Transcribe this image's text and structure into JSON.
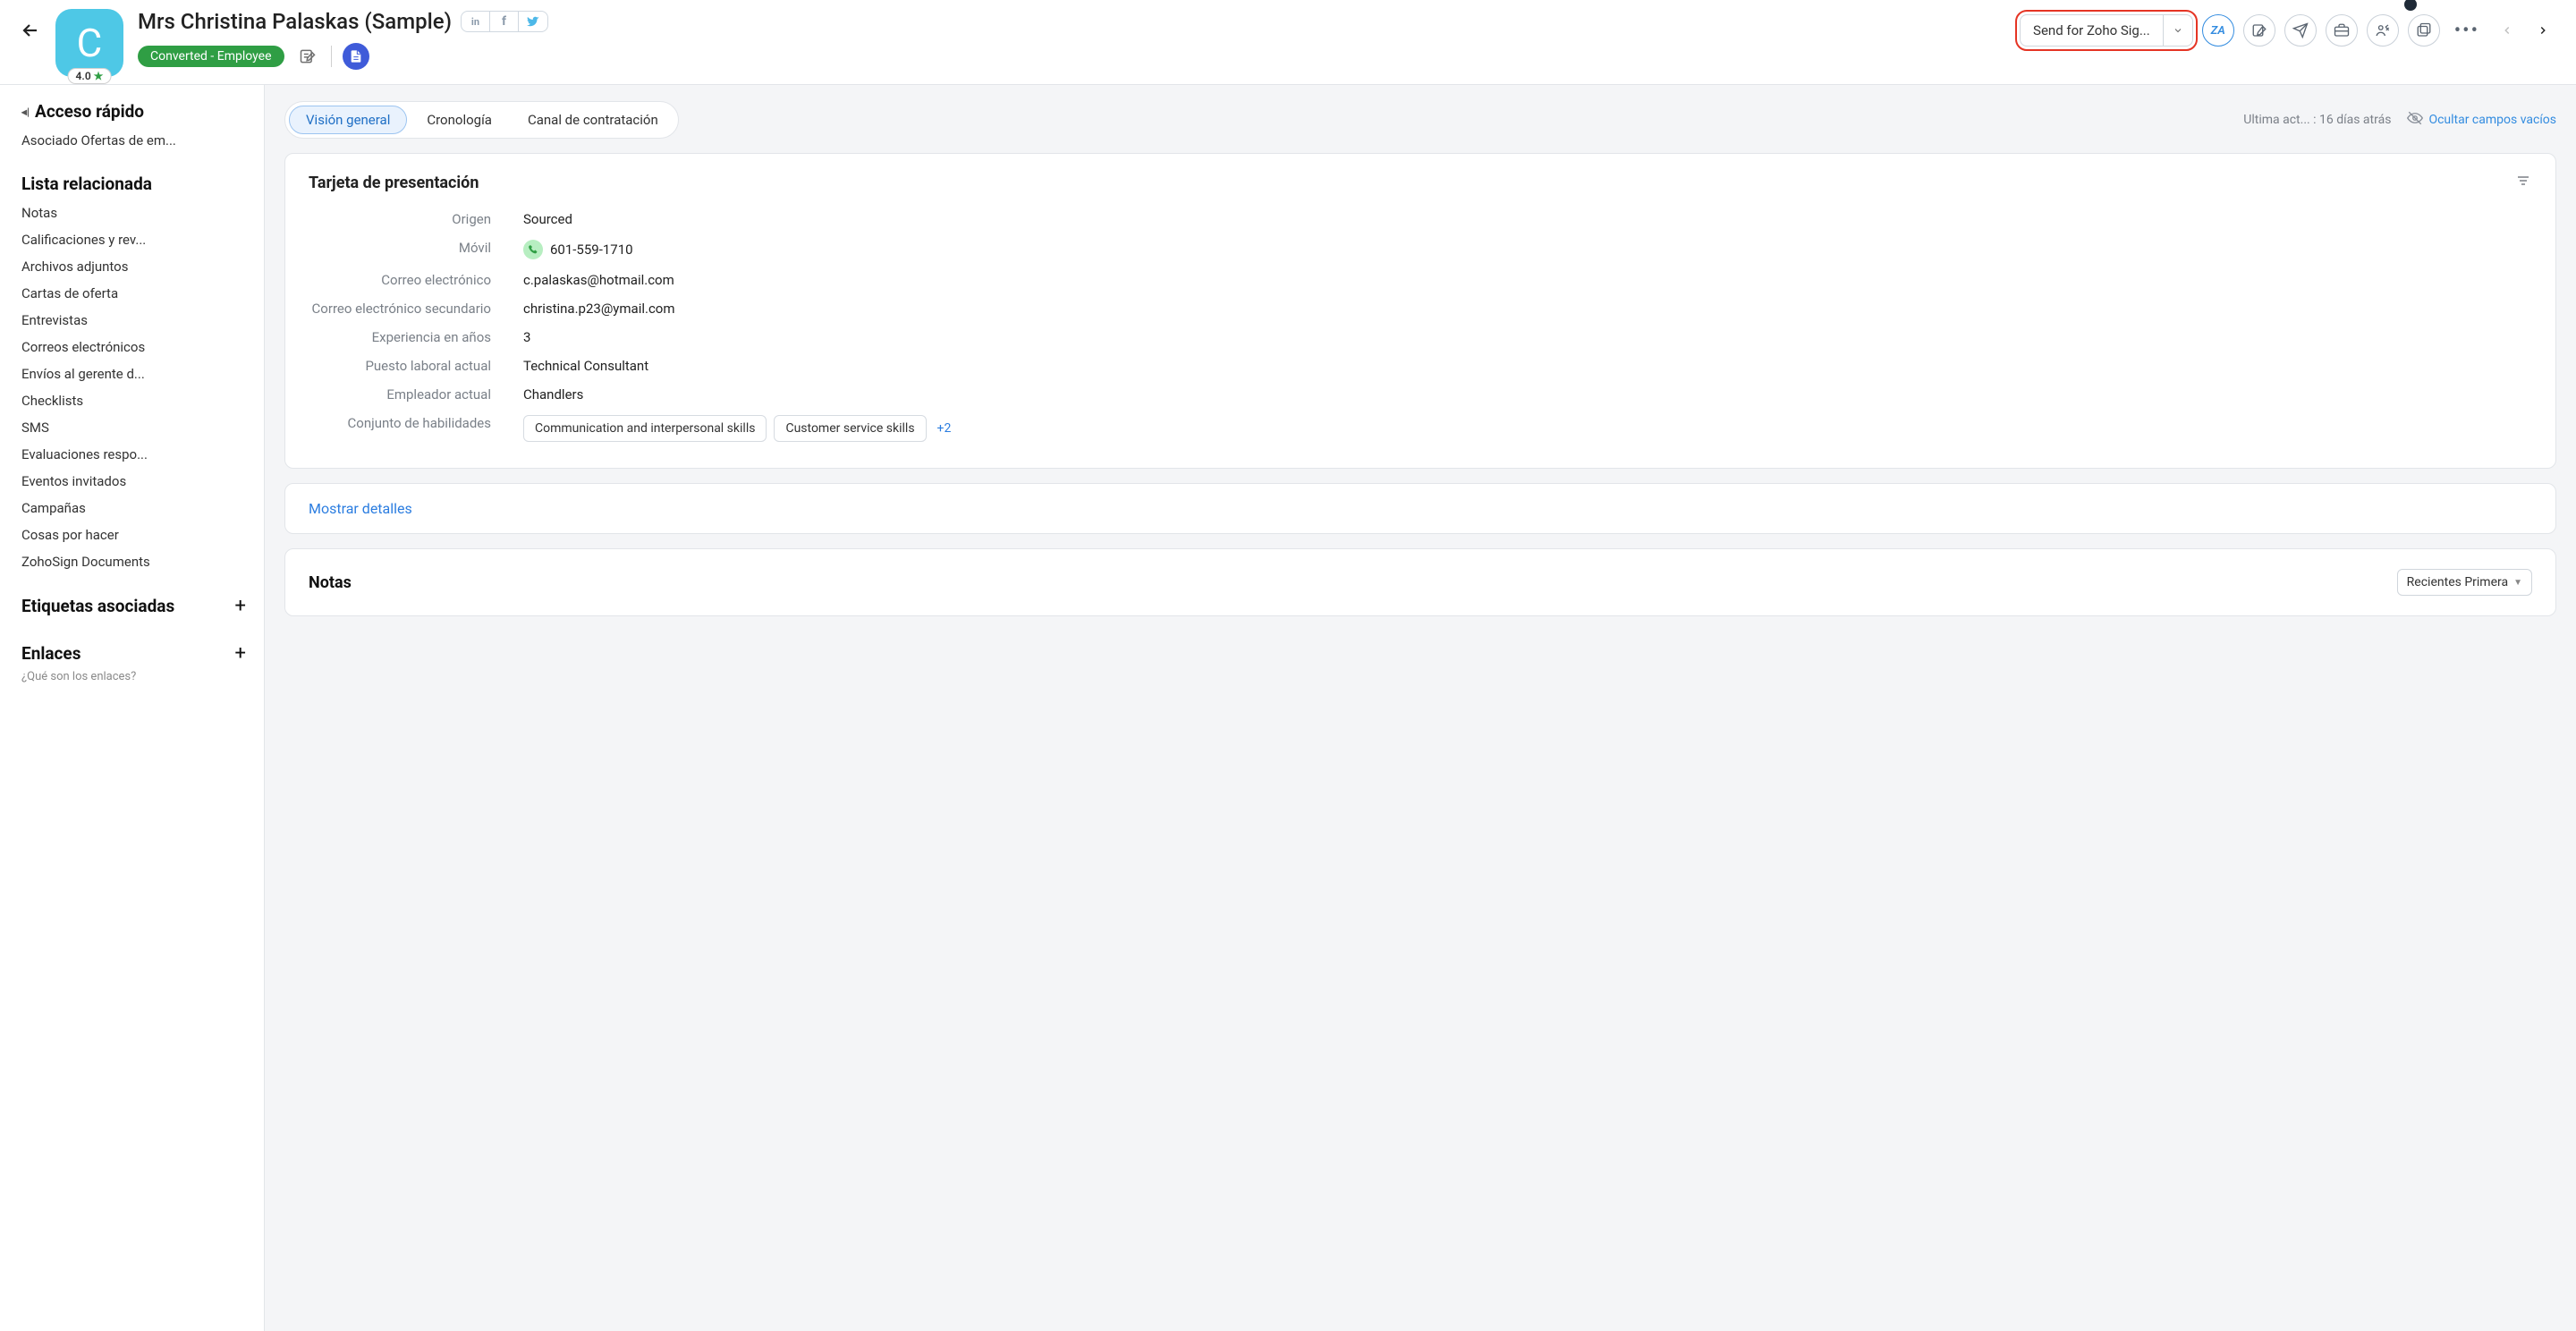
{
  "header": {
    "avatar_initial": "C",
    "rating": "4.0",
    "name": "Mrs Christina Palaskas (Sample)",
    "status": "Converted - Employee",
    "primary_action": "Send for Zoho Sig...",
    "circle_accent_label": "ZA"
  },
  "sidebar": {
    "quick_access_title": "Acceso rápido",
    "quick_access_item": "Asociado Ofertas de em...",
    "related_list_title": "Lista relacionada",
    "related_items": [
      "Notas",
      "Calificaciones y rev...",
      "Archivos adjuntos",
      "Cartas de oferta",
      "Entrevistas",
      "Correos electrónicos",
      "Envíos al gerente d...",
      "Checklists",
      "SMS",
      "Evaluaciones respo...",
      "Eventos invitados",
      "Campañas",
      "Cosas por hacer",
      "ZohoSign Documents"
    ],
    "tags_title": "Etiquetas asociadas",
    "links_title": "Enlaces",
    "links_sub": "¿Qué son los enlaces?"
  },
  "tabs": {
    "items": [
      "Visión general",
      "Cronología",
      "Canal de contratación"
    ],
    "active_index": 0
  },
  "meta": {
    "last_activity_prefix": "Ultima act... :",
    "last_activity_value": "16 días atrás",
    "hide_empty_label": "Ocultar campos vacíos"
  },
  "card": {
    "title": "Tarjeta de presentación",
    "fields": [
      {
        "label": "Origen",
        "value": "Sourced"
      },
      {
        "label": "Móvil",
        "value": "601-559-1710",
        "phone": true
      },
      {
        "label": "Correo electrónico",
        "value": "c.palaskas@hotmail.com"
      },
      {
        "label": "Correo electrónico secundario",
        "value": "christina.p23@ymail.com"
      },
      {
        "label": "Experiencia en años",
        "value": "3"
      },
      {
        "label": "Puesto laboral actual",
        "value": "Technical Consultant"
      },
      {
        "label": "Empleador actual",
        "value": "Chandlers"
      }
    ],
    "skills_label": "Conjunto de habilidades",
    "skills": [
      "Communication and interpersonal skills",
      "Customer service skills"
    ],
    "skills_more": "+2"
  },
  "show_details": "Mostrar detalles",
  "notes": {
    "title": "Notas",
    "sort_label": "Recientes Primera"
  }
}
